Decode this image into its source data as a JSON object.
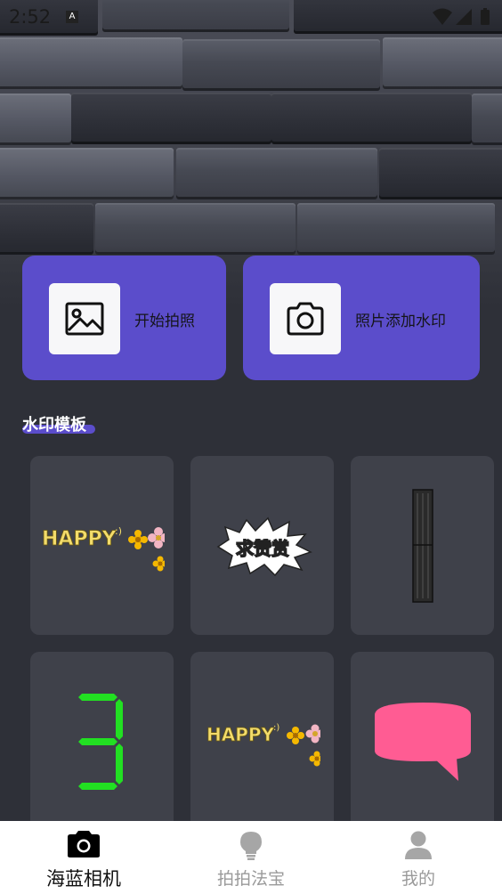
{
  "status_bar": {
    "time": "2:52",
    "notification_icon": "A"
  },
  "actions": [
    {
      "label": "开始拍照",
      "icon": "image-icon"
    },
    {
      "label": "照片添加水印",
      "icon": "camera-icon"
    }
  ],
  "section": {
    "title": "水印模板"
  },
  "templates": [
    {
      "name": "happy-flowers-sticker",
      "text": "HAPPY"
    },
    {
      "name": "qiu-zan-shang-sticker",
      "text": "求赞赏"
    },
    {
      "name": "digit-1-sticker",
      "text": ""
    },
    {
      "name": "digit-3-sticker",
      "text": ""
    },
    {
      "name": "happy-flowers-sticker-2",
      "text": "HAPPY"
    },
    {
      "name": "pink-speech-bubble-sticker",
      "text": ""
    }
  ],
  "nav": [
    {
      "label": "海蓝相机",
      "icon": "camera-icon",
      "active": true
    },
    {
      "label": "拍拍法宝",
      "icon": "lightbulb-icon",
      "active": false
    },
    {
      "label": "我的",
      "icon": "person-icon",
      "active": false
    }
  ],
  "colors": {
    "accent": "#5b4dcb",
    "background": "#2e3038",
    "tile": "#3f414a",
    "nav_bg": "#ffffff"
  }
}
